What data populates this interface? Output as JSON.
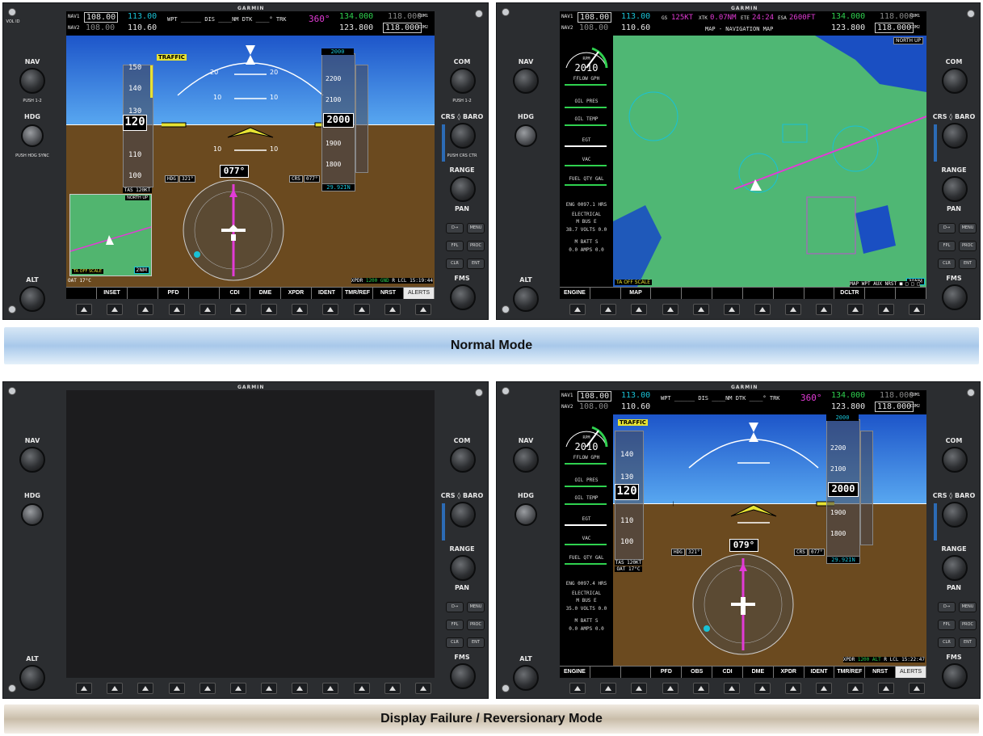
{
  "brand": "GARMIN",
  "captions": {
    "normal": "Normal Mode",
    "failure": "Display Failure / Reversionary Mode"
  },
  "knobs": {
    "nav": "NAV",
    "hdg": "HDG",
    "alt": "ALT",
    "com": "COM",
    "crs_baro": "CRS ◊ BARO",
    "range": "RANGE",
    "pan": "PAN",
    "fms": "FMS",
    "push12": "PUSH 1-2",
    "push_hdg_sync": "PUSH HDG SYNC",
    "push_crs_ctr": "PUSH CRS CTR",
    "push_crsr": "PUSH CRSR",
    "vol_id": "VOL ID"
  },
  "side_buttons": {
    "direct": "D→",
    "menu": "MENU",
    "fpl": "FPL",
    "proc": "PROC",
    "clr": "CLR",
    "ent": "ENT"
  },
  "top_bar": {
    "nav1_label": "NAV1",
    "nav2_label": "NAV2",
    "nav1_active": "108.00",
    "nav1_standby": "113.00",
    "nav2_active": "108.00",
    "nav2_standby": "110.60",
    "com1_active": "134.000",
    "com1_standby": "118.000",
    "com2_active": "123.800",
    "com2_standby": "118.000",
    "com1_label": "COM1",
    "com2_label": "COM2",
    "pfd_fields": "WPT ______ DIS ____NM DTK ____° TRK",
    "trk": "360°",
    "mfd_gs_label": "GS",
    "mfd_gs": "125KT",
    "mfd_xtk_label": "XTK",
    "mfd_xtk": "0.07NM",
    "mfd_ete_label": "ETE",
    "mfd_ete": "24:24",
    "mfd_esa_label": "ESA",
    "mfd_esa": "2600FT",
    "mfd_page": "MAP - NAVIGATION MAP"
  },
  "pfd_normal": {
    "traffic": "TRAFFIC",
    "airspeed_ticks": [
      "150",
      "140",
      "130",
      "110",
      "100"
    ],
    "airspeed": "120",
    "tas": "TAS 120KT",
    "altitude_ticks": [
      "2200",
      "2100",
      "1900",
      "1800"
    ],
    "altitude": "2000",
    "alt_bug": "2000",
    "baro": "29.92IN",
    "pitch_labels": [
      "20",
      "20",
      "10",
      "10",
      "10",
      "10"
    ],
    "heading": "077°",
    "hdg_bug_label": "HDG",
    "hdg_bug": "321°",
    "crs_label": "CRS",
    "crs": "077°",
    "inset_north_up": "NORTH UP",
    "inset_tas_off": "TA OFF SCALE",
    "inset_range": "2NM",
    "oat": "OAT 17°C",
    "xpdr_label": "XPDR",
    "xpdr_code": "1200",
    "xpdr_mode": "GND",
    "xpdr_r": "R",
    "time_label": "LCL",
    "time": "15:19:44",
    "softkeys": [
      "",
      "INSET",
      "",
      "PFD",
      "",
      "CDI",
      "DME",
      "XPDR",
      "IDENT",
      "TMR/REF",
      "NRST",
      "ALERTS"
    ]
  },
  "mfd_normal": {
    "rpm_label": "RPM",
    "rpm": "2010",
    "ffl_label": "FFLOW GPH",
    "oil_pres": "OIL PRES",
    "oil_temp": "OIL TEMP",
    "egt": "EGT",
    "vac": "VAC",
    "fuel_qty": "FUEL QTY GAL",
    "eng_hrs": "ENG 0097.1 HRS",
    "electrical": "ELECTRICAL",
    "bus_m": "M",
    "bus_label": "BUS",
    "bus_e": "E",
    "volts_m": "38.7",
    "volts_label": "VOLTS",
    "volts_e": "0.0",
    "batt_m": "M",
    "batt_label": "BATT",
    "batt_s": "S",
    "amps_m": "0.0",
    "amps_label": "AMPS",
    "amps_s": "0.0",
    "map_north_up": "NORTH UP",
    "map_range": "30NM",
    "ta_off": "TA OFF SCALE",
    "page_group": "MAP WPT AUX NRST",
    "page_dots": "■ □ □ □",
    "softkeys": [
      "ENGINE",
      "",
      "MAP",
      "",
      "",
      "",
      "",
      "",
      "",
      "DCLTR",
      "",
      ""
    ]
  },
  "reversionary": {
    "pfd_fields": "WPT ______ DIS ____NM DTK ____° TRK",
    "trk": "360°",
    "rpm": "2010",
    "airspeed": "120",
    "airspeed_ticks": [
      "140",
      "130",
      "110",
      "100"
    ],
    "tas": "TAS 120KT",
    "oat": "OAT 17°C",
    "altitude": "2000",
    "alt_bug": "2000",
    "altitude_ticks": [
      "2200",
      "2100",
      "1900",
      "1800"
    ],
    "baro": "29.92IN",
    "heading": "079°",
    "hdg_bug_label": "HDG",
    "hdg_bug": "321°",
    "crs_label": "CRS",
    "crs": "077°",
    "traffic": "TRAFFIC",
    "eng_hrs": "ENG 0097.4 HRS",
    "volts_m": "35.0",
    "volts_e": "0.0",
    "amps_m": "0.0",
    "amps_s": "0.0",
    "xpdr_code": "1200",
    "xpdr_mode": "ALT",
    "xpdr_r": "R",
    "time_label": "LCL",
    "time": "15:22:47",
    "softkeys": [
      "ENGINE",
      "",
      "",
      "PFD",
      "OBS",
      "CDI",
      "DME",
      "XPDR",
      "IDENT",
      "TMR/REF",
      "NRST",
      "ALERTS"
    ]
  },
  "failed_display": {
    "softkeys": [
      "",
      "",
      "",
      "",
      "",
      "",
      "",
      "",
      "",
      "",
      "",
      ""
    ]
  },
  "colors": {
    "sky": "#2f6fd8",
    "ground": "#6b4a1f",
    "bezel": "#2b2d30",
    "cyan": "#19c2d6",
    "magenta": "#e23bd6",
    "map_land": "#4fb774",
    "map_water": "#1a4fc2"
  }
}
